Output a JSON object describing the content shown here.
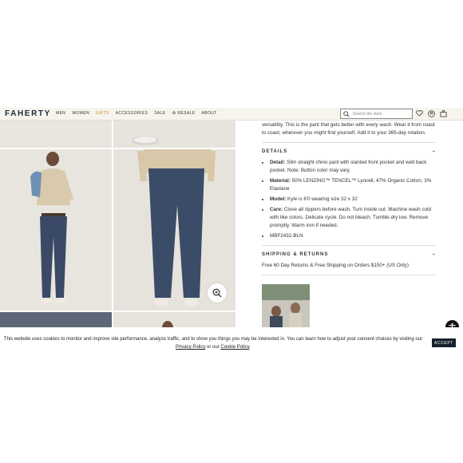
{
  "header": {
    "logo": "FAHERTY",
    "nav": [
      "MEN",
      "WOMEN",
      "GIFTS",
      "ACCESSORIES",
      "SALE",
      "RESALE",
      "ABOUT"
    ],
    "search_placeholder": "Search the store",
    "icons": [
      "heart-icon",
      "account-icon",
      "bag-icon"
    ],
    "colors": {
      "bg": "#f7f4ee",
      "gifts": "#c98a1e",
      "logo": "#1e2a3a"
    }
  },
  "product": {
    "intro": "versatility. This is the pant that gets better with every wash. Wear it from coast to coast, wherever you might find yourself. Add it to your 365-day rotation.",
    "details_title": "DETAILS",
    "details": [
      {
        "label": "Detail:",
        "text": "Slim straight chino pant with slanted front pocket and welt back pocket. Note: Button color may vary."
      },
      {
        "label": "Material:",
        "text": "50% LENZING™ TENCEL™ Lyocell, 47% Organic Cotton, 3% Elastane"
      },
      {
        "label": "Model:",
        "text": "Kyle is 6'0 wearing size 32 x 32"
      },
      {
        "label": "Care:",
        "text": "Close all zippers before wash. Turn inside out. Machine wash cold with like colors. Delicate cycle. Do not bleach. Tumble dry low. Remove promptly. Warm iron if needed."
      },
      {
        "label": "",
        "text": "MBF2432-BLN"
      }
    ],
    "shipping_title": "SHIPPING & RETURNS",
    "shipping_text": "Free 60 Day Returns & Free Shipping on Orders $150+ (US Only)",
    "collapse_glyph": "–"
  },
  "consent": {
    "text_before": "This website uses cookies to monitor and improve site performance, analyze traffic, and to show you things you may be interested in. You can learn how to adjust your consent choices by visiting our ",
    "privacy_link": "Privacy Policy",
    "text_middle": " or our ",
    "cookie_link": "Cookie Policy",
    "text_end": ".",
    "accept_label": "ACCEPT"
  },
  "close_glyph": "×"
}
